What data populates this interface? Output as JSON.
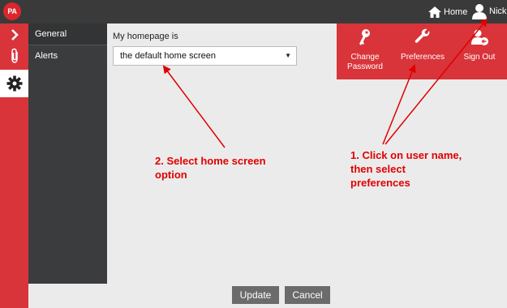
{
  "brand": {
    "logo_text": "PA",
    "accent": "#d8343a",
    "topbar_color": "#3a3a3a",
    "sidebar_color": "#3b3c3e"
  },
  "topbar": {
    "home_label": "Home",
    "home_icon": "home-icon",
    "user_name": "Nick",
    "user_icon": "user-icon"
  },
  "rail": {
    "items": [
      {
        "icon": "chevron-right-icon"
      },
      {
        "icon": "paperclip-icon"
      },
      {
        "icon": "gear-icon",
        "active": true
      }
    ]
  },
  "subnav": {
    "items": [
      {
        "label": "General",
        "active": true
      },
      {
        "label": "Alerts"
      }
    ]
  },
  "main": {
    "homepage_label": "My homepage is",
    "homepage_value": "the default home screen"
  },
  "user_menu": {
    "items": [
      {
        "label_line1": "Change",
        "label_line2": "Password",
        "icon": "key-icon"
      },
      {
        "label_line1": "Preferences",
        "label_line2": "",
        "icon": "wrench-icon"
      },
      {
        "label_line1": "Sign Out",
        "label_line2": "",
        "icon": "sign-out-user-icon"
      }
    ]
  },
  "annotations": {
    "step2": {
      "line1": "2. Select home screen",
      "line2": "option"
    },
    "step1": {
      "line1": "1. Click on user name,",
      "line2": "then select",
      "line3": "preferences"
    }
  },
  "footer": {
    "update_label": "Update",
    "cancel_label": "Cancel"
  }
}
